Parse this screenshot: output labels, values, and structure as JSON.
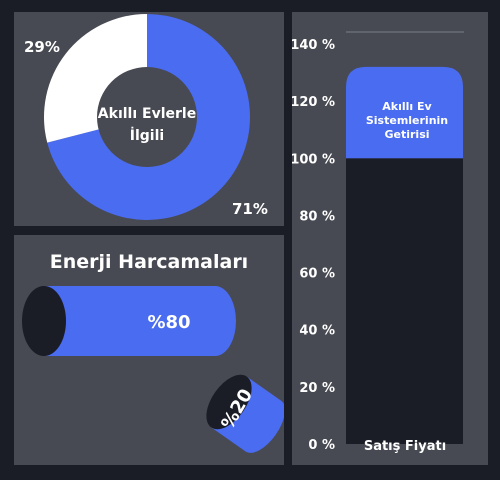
{
  "chart_data": [
    {
      "type": "pie",
      "title": "Akıllı Evlerle İlgili",
      "title_lines": [
        "Akıllı Evlerle",
        "İlgili"
      ],
      "slices": [
        {
          "label": "71%",
          "value": 71,
          "color": "#4a6cf0"
        },
        {
          "label": "29%",
          "value": 29,
          "color": "#ffffff"
        }
      ]
    },
    {
      "type": "bar",
      "title": "Enerji Harcamaları",
      "categories": [
        "%80",
        "%20"
      ],
      "values": [
        80,
        20
      ],
      "color": "#4a6cf0"
    },
    {
      "type": "bar",
      "categories": [
        "Satış Fiyatı"
      ],
      "series": [
        {
          "values": [
            100
          ],
          "color": "#1a1c26"
        },
        {
          "values": [
            32
          ],
          "color": "#4a6cf0",
          "label_lines": [
            "Akıllı Ev",
            "Sistemlerinin",
            "Getirisi"
          ]
        }
      ],
      "yticks": [
        "0 %",
        "20 %",
        "40 %",
        "60 %",
        "80 %",
        "100 %",
        "120 %",
        "140 %"
      ],
      "ylim": [
        0,
        140
      ],
      "xlabel": "Satış Fiyatı"
    }
  ]
}
